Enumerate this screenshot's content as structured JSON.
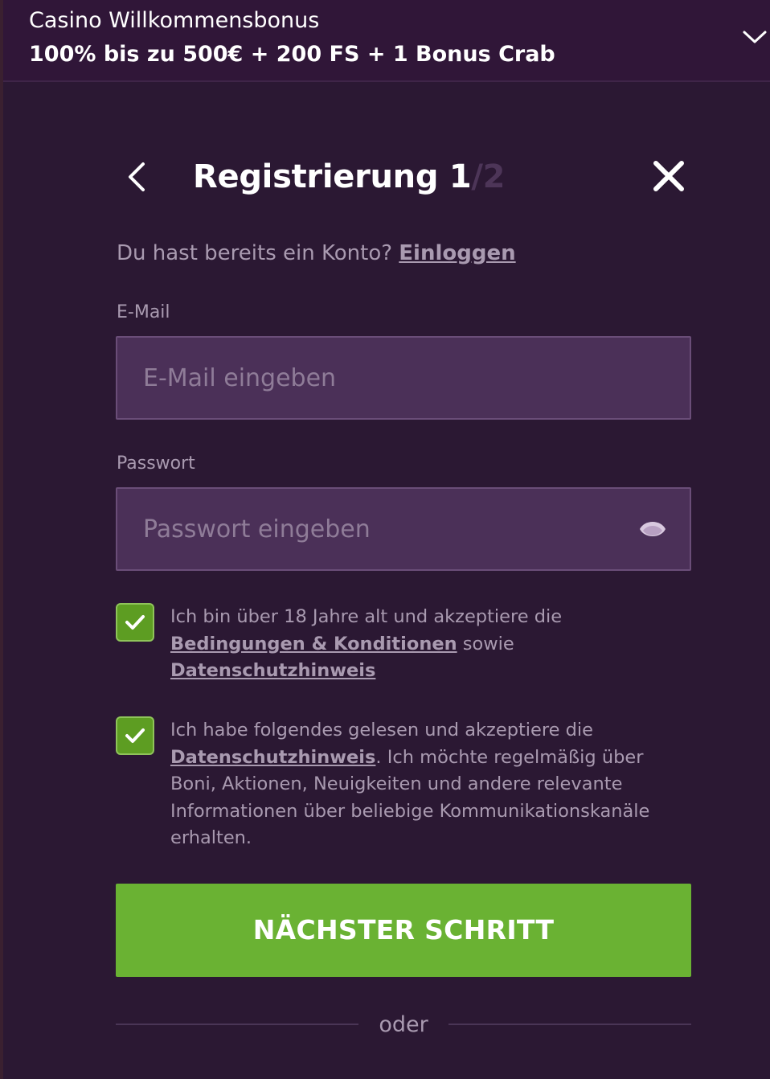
{
  "banner": {
    "title": "Casino Willkommensbonus",
    "offer": "100% bis zu 500€ + 200 FS + 1 Bonus Crab",
    "expand_icon": "chevron-down-icon"
  },
  "header": {
    "back_icon": "chevron-left-icon",
    "title_prefix": "Registrierung ",
    "step_current": "1",
    "step_total": "/2",
    "close_icon": "close-icon"
  },
  "login_prompt": {
    "text": "Du hast bereits ein Konto? ",
    "link": "Einloggen"
  },
  "email": {
    "label": "E-Mail",
    "placeholder": "E-Mail eingeben",
    "value": ""
  },
  "password": {
    "label": "Passwort",
    "placeholder": "Passwort eingeben",
    "value": "",
    "toggle_icon": "eye-icon"
  },
  "consents": [
    {
      "checked": true,
      "text_before": "Ich bin über 18 Jahre alt und akzeptiere die ",
      "link1": "Bedingungen & Konditionen",
      "text_middle": " sowie ",
      "link2": "Datenschutzhinweis"
    },
    {
      "checked": true,
      "text_before": "Ich habe folgendes gelesen und akzeptiere die ",
      "link1": "Datenschutzhinweis",
      "text_after": ". Ich möchte regelmäßig über Boni, Aktionen, Neuigkeiten und andere relevante Informationen über beliebige Kommunikationskanäle erhalten."
    }
  ],
  "next_button": {
    "label": "NÄCHSTER SCHRITT"
  },
  "divider": {
    "text": "oder"
  },
  "colors": {
    "background": "#2b1833",
    "banner": "#301638",
    "input_bg": "#4b3058",
    "muted_text": "#a99ab0",
    "accent_green": "#6ab233"
  }
}
